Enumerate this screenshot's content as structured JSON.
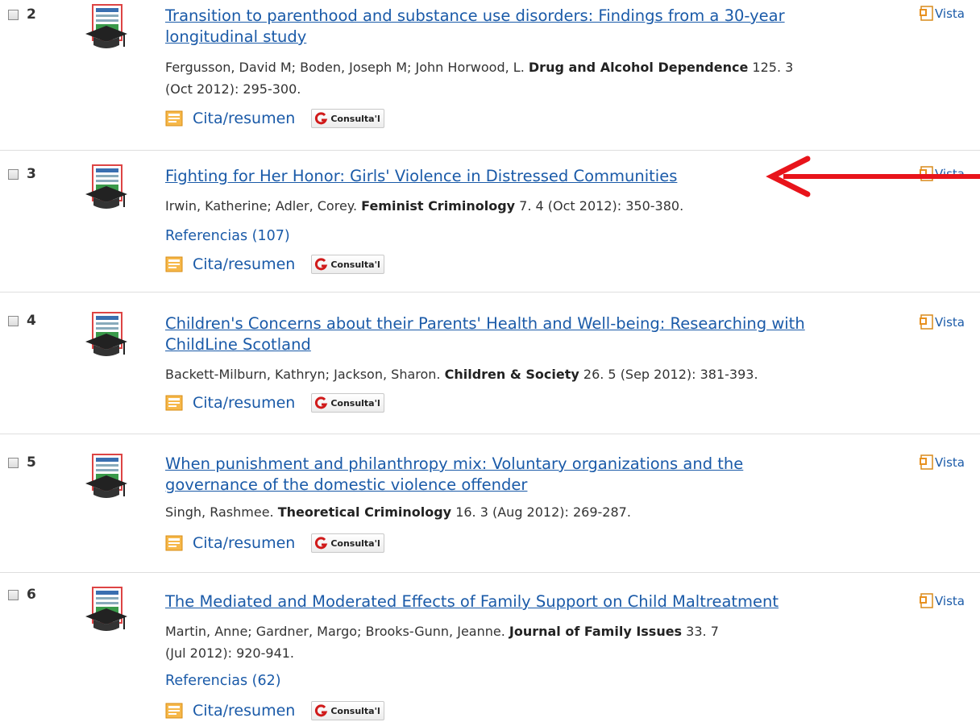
{
  "results": [
    {
      "number": "2",
      "title_lines": [
        "Transition to parenthood and substance use disorders: Findings from a 30-year",
        "longitudinal study"
      ],
      "authors": "Fergusson, David M; Boden, Joseph M; John Horwood, L.",
      "journal": "Drug and Alcohol Dependence",
      "citation_tail": "125. 3",
      "citation_line2": "(Oct 2012): 295-300.",
      "citation_abstract_label": "Cita/resumen",
      "consulta_label": "Consulta'l",
      "vista_label": "Vista"
    },
    {
      "number": "3",
      "title_lines": [
        "Fighting for Her Honor: Girls' Violence in Distressed Communities"
      ],
      "authors": "Irwin, Katherine; Adler, Corey.",
      "journal": "Feminist Criminology",
      "citation_tail": "7. 4  (Oct 2012): 350-380.",
      "references_label": "Referencias (107)",
      "citation_abstract_label": "Cita/resumen",
      "consulta_label": "Consulta'l",
      "vista_label": "Vista"
    },
    {
      "number": "4",
      "title_lines": [
        "Children's Concerns about their Parents' Health and Well-being: Researching with",
        "ChildLine Scotland"
      ],
      "authors": "Backett-Milburn, Kathryn; Jackson, Sharon.",
      "journal": "Children & Society",
      "citation_tail": "26. 5  (Sep 2012): 381-393.",
      "citation_abstract_label": "Cita/resumen",
      "consulta_label": "Consulta'l",
      "vista_label": "Vista"
    },
    {
      "number": "5",
      "title_lines": [
        "When punishment and philanthropy mix: Voluntary organizations and the",
        "governance of the domestic violence offender"
      ],
      "authors": "Singh, Rashmee.",
      "journal": "Theoretical Criminology",
      "citation_tail": "16. 3  (Aug 2012): 269-287.",
      "citation_abstract_label": "Cita/resumen",
      "consulta_label": "Consulta'l",
      "vista_label": "Vista"
    },
    {
      "number": "6",
      "title_lines": [
        "The Mediated and Moderated Effects of Family Support on Child Maltreatment"
      ],
      "authors": "Martin, Anne; Gardner, Margo; Brooks-Gunn, Jeanne.",
      "journal": "Journal of Family Issues",
      "citation_tail": "33. 7",
      "citation_line2": "(Jul 2012): 920-941.",
      "references_label": "Referencias (62)",
      "citation_abstract_label": "Cita/resumen",
      "consulta_label": "Consulta'l",
      "vista_label": "Vista"
    }
  ],
  "colors": {
    "link": "#1a5aa8",
    "arrow": "#e8141b",
    "divider": "#dedede"
  }
}
